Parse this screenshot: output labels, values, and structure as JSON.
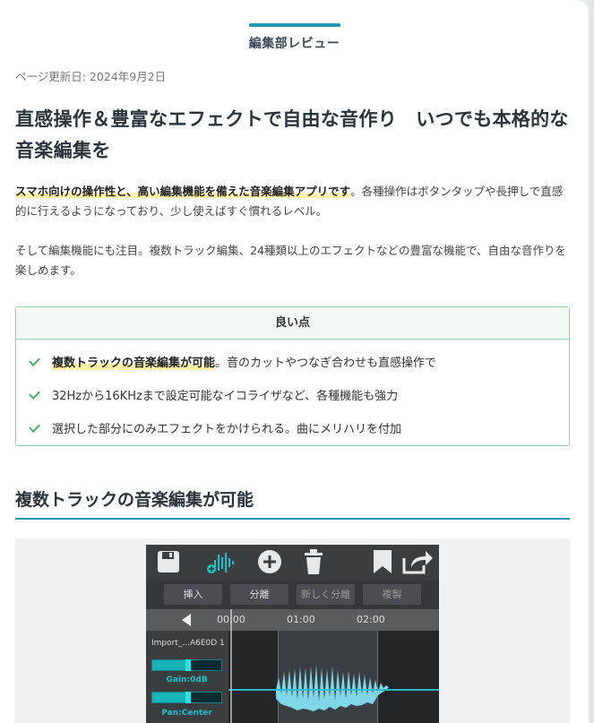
{
  "review_label": "編集部レビュー",
  "update_date": "ページ更新日: 2024年9月2日",
  "title": "直感操作＆豊富なエフェクトで自由な音作り　いつでも本格的な音楽編集を",
  "para1": {
    "highlight": "スマホ向けの操作性と、高い編集機能を備えた音楽編集アプリです",
    "rest": "。各種操作はボタンタップや長押しで直感的に行えるようになっており、少し使えばすぐ慣れるレベル。"
  },
  "para2": "そして編集機能にも注目。複数トラック編集、24種類以上のエフェクトなどの豊富な機能で、自由な音作りを楽しめます。",
  "good_points": {
    "header": "良い点",
    "items": [
      {
        "highlight": "複数トラックの音楽編集が可能",
        "rest": "。音のカットやつなぎ合わせも直感操作で"
      },
      {
        "highlight": "",
        "rest": "32Hzから16KHzまで設定可能なイコライザなど、各種機能も強力"
      },
      {
        "highlight": "",
        "rest": "選択した部分にのみエフェクトをかけられる。曲にメリハリを付加"
      }
    ]
  },
  "section_heading": "複数トラックの音楽編集が可能",
  "app": {
    "buttons": [
      "挿入",
      "分離",
      "新しく分離",
      "複製"
    ],
    "time_ticks": [
      "00:00",
      "01:00",
      "02:00"
    ],
    "track_name": "Import_...A6E0D 1",
    "gain_label": "Gain:0dB",
    "pan_label": "Pan:Center",
    "accent": "#18b3b8",
    "icons": [
      "save-icon",
      "waveform-add-icon",
      "add-circle-icon",
      "trash-icon",
      "bookmark-icon",
      "share-icon"
    ]
  }
}
